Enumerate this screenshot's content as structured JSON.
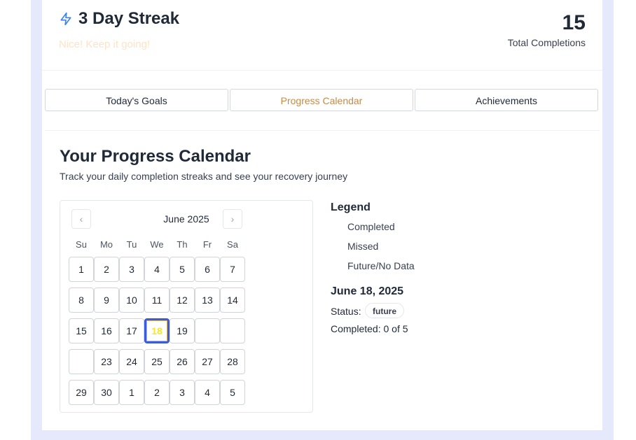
{
  "streak": {
    "title": "3 Day Streak",
    "subtitle": "Nice! Keep it going!",
    "icon": "lightning-icon",
    "total_number": "15",
    "total_label": "Total Completions"
  },
  "tabs": [
    {
      "label": "Today's Goals",
      "active": false
    },
    {
      "label": "Progress Calendar",
      "active": true
    },
    {
      "label": "Achievements",
      "active": false
    }
  ],
  "section": {
    "title": "Your Progress Calendar",
    "subtitle": "Track your daily completion streaks and see your recovery journey"
  },
  "calendar": {
    "month": "June 2025",
    "prev_icon": "chevron-left-icon",
    "next_icon": "chevron-right-icon",
    "weekdays": [
      "Su",
      "Mo",
      "Tu",
      "We",
      "Th",
      "Fr",
      "Sa"
    ],
    "weeks": [
      [
        "1",
        "2",
        "3",
        "4",
        "5",
        "6",
        "7"
      ],
      [
        "8",
        "9",
        "10",
        "11",
        "12",
        "13",
        "14"
      ],
      [
        "15",
        "16",
        "17",
        "18",
        "19",
        "",
        ""
      ],
      [
        "",
        "23",
        "24",
        "25",
        "26",
        "27",
        "28"
      ],
      [
        "29",
        "30",
        "1",
        "2",
        "3",
        "4",
        "5"
      ]
    ],
    "selected_day": "18"
  },
  "legend": {
    "title": "Legend",
    "items": [
      "Completed",
      "Missed",
      "Future/No Data"
    ]
  },
  "details": {
    "date": "June 18, 2025",
    "status_label": "Status:",
    "status_value": "future",
    "completed_text": "Completed: 0 of 5"
  },
  "colors": {
    "accent_tab": "#c48a4a",
    "selected_border": "#3b5bdb",
    "selected_text": "#f8e71c",
    "background_tint": "#e5e9fb"
  }
}
